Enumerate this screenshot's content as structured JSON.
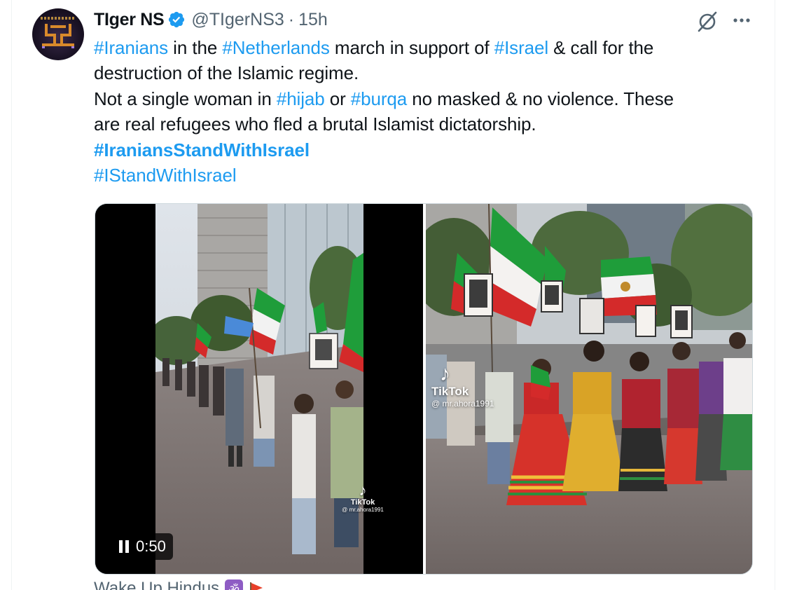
{
  "author": {
    "name": "TIger NS",
    "handle": "@TIgerNS3",
    "separator": "·",
    "time": "15h",
    "verified": true,
    "verified_color": "#1d9bf0"
  },
  "tweet": {
    "line1": {
      "t1": "#Iranians",
      "t2": " in the ",
      "t3": "#Netherlands",
      "t4": " march in support of ",
      "t5": "#Israel",
      "t6": " & call for the"
    },
    "line2": "destruction of the Islamic regime.",
    "line3": {
      "t1": "Not a single woman in ",
      "t2": "#hijab",
      "t3": " or ",
      "t4": "#burqa",
      "t5": " no masked & no violence. These"
    },
    "line4": "are real refugees who fled a brutal Islamist dictatorship.",
    "line5": "#IraniansStandWithIsrael",
    "line6": "#IStandWithIsrael"
  },
  "colors": {
    "link": "#1d9bf0",
    "text": "#0f1419",
    "secondary": "#536471",
    "border": "#cfd9de"
  },
  "media": {
    "left": {
      "kind": "video",
      "duration": "0:50",
      "state": "playing",
      "watermark": {
        "name": "TikTok",
        "user": "@ mr.ahora1991"
      }
    },
    "right": {
      "kind": "image",
      "watermark": {
        "name": "TikTok",
        "user": "@ mr.ahora1991"
      }
    }
  },
  "next_tweet": {
    "name_partial": "Wake Up Hindus",
    "emoji1": "ॐ"
  },
  "icons": [
    "verified-badge-icon",
    "grok-icon",
    "more-options-icon",
    "pause-icon",
    "tiktok-logo-icon",
    "om-emoji-icon",
    "saffron-flag-icon"
  ]
}
